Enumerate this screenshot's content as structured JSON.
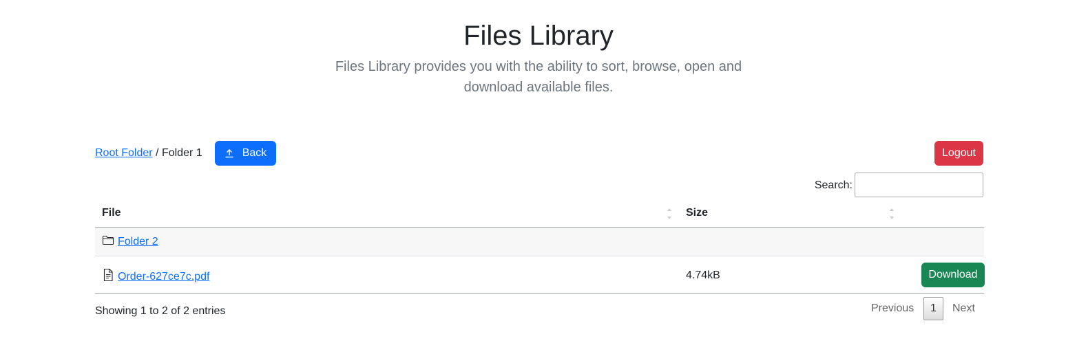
{
  "header": {
    "title": "Files Library",
    "subtitle": "Files Library provides you with the ability to sort, browse, open and download available files."
  },
  "breadcrumb": {
    "root_label": "Root Folder",
    "separator": "/",
    "current": "Folder 1"
  },
  "toolbar": {
    "back_label": "Back",
    "back_icon": "upload-arrow-icon",
    "logout_label": "Logout"
  },
  "search": {
    "label": "Search:",
    "value": "",
    "placeholder": ""
  },
  "table": {
    "columns": [
      "File",
      "Size",
      ""
    ],
    "rows": [
      {
        "type": "folder",
        "icon": "folder-icon",
        "name": "Folder 2",
        "size": "",
        "action": ""
      },
      {
        "type": "file",
        "icon": "file-text-icon",
        "name": "Order-627ce7c.pdf",
        "size": "4.74kB",
        "action": "Download"
      }
    ]
  },
  "footer": {
    "info": "Showing 1 to 2 of 2 entries",
    "pagination": {
      "previous": "Previous",
      "current_page": "1",
      "next": "Next"
    }
  },
  "colors": {
    "primary": "#0d6efd",
    "danger": "#dc3545",
    "success": "#198754",
    "muted": "#6c757d"
  }
}
